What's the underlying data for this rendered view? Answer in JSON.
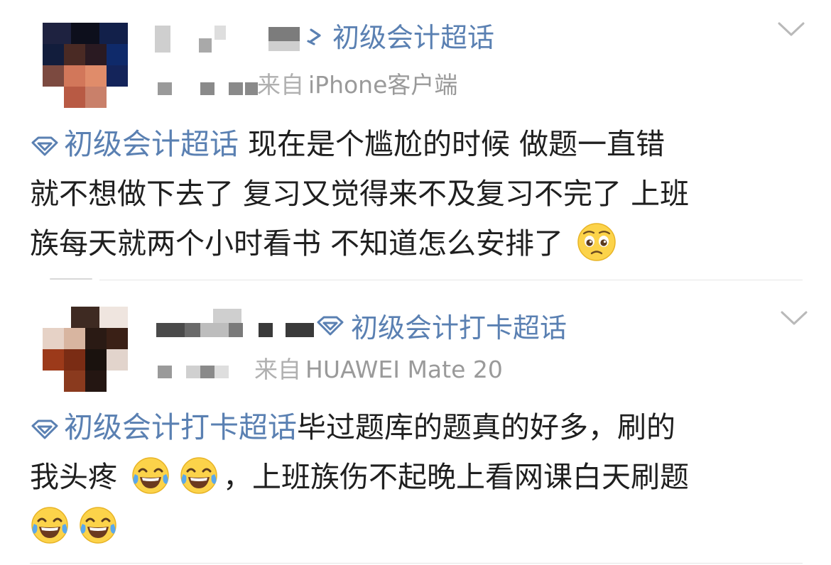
{
  "posts": [
    {
      "topic_tag": "初级会计超话",
      "source": "来自iPhone客户端",
      "source_visible": "iPhone客户端",
      "source_prefix": "来自",
      "content": {
        "tag": "初级会计超话",
        "line1": "现在是个尴尬的时候 做题一直错",
        "line2": "就不想做下去了 复习又觉得来不及复习不完了 上班",
        "line3": "族每天就两个小时看书  不知道怎么安排了",
        "emoji": [
          "pleading-face"
        ]
      }
    },
    {
      "topic_tag": "初级会计打卡超话",
      "source": "来自HUAWEI Mate 20",
      "source_visible": "HUAWEI Mate 20",
      "source_prefix": "来自",
      "content": {
        "tag": "初级会计打卡超话",
        "line1": "毕过题库的题真的好多，刷的",
        "line2a": "我头疼",
        "line2b": "，上班族伤不起晚上看网课白天刷题",
        "emoji": [
          "tears-of-joy",
          "tears-of-joy",
          "tears-of-joy",
          "tears-of-joy"
        ]
      }
    }
  ],
  "colors": {
    "topic_blue": "#5a80b2",
    "body_text": "#1f1f1f",
    "meta_gray": "#9a9a9a",
    "divider": "#e6e6e6"
  },
  "icons": {
    "topic": "supertopic-diamond-icon",
    "expand": "chevron-down-icon",
    "avatar": "pixelated-avatar"
  }
}
